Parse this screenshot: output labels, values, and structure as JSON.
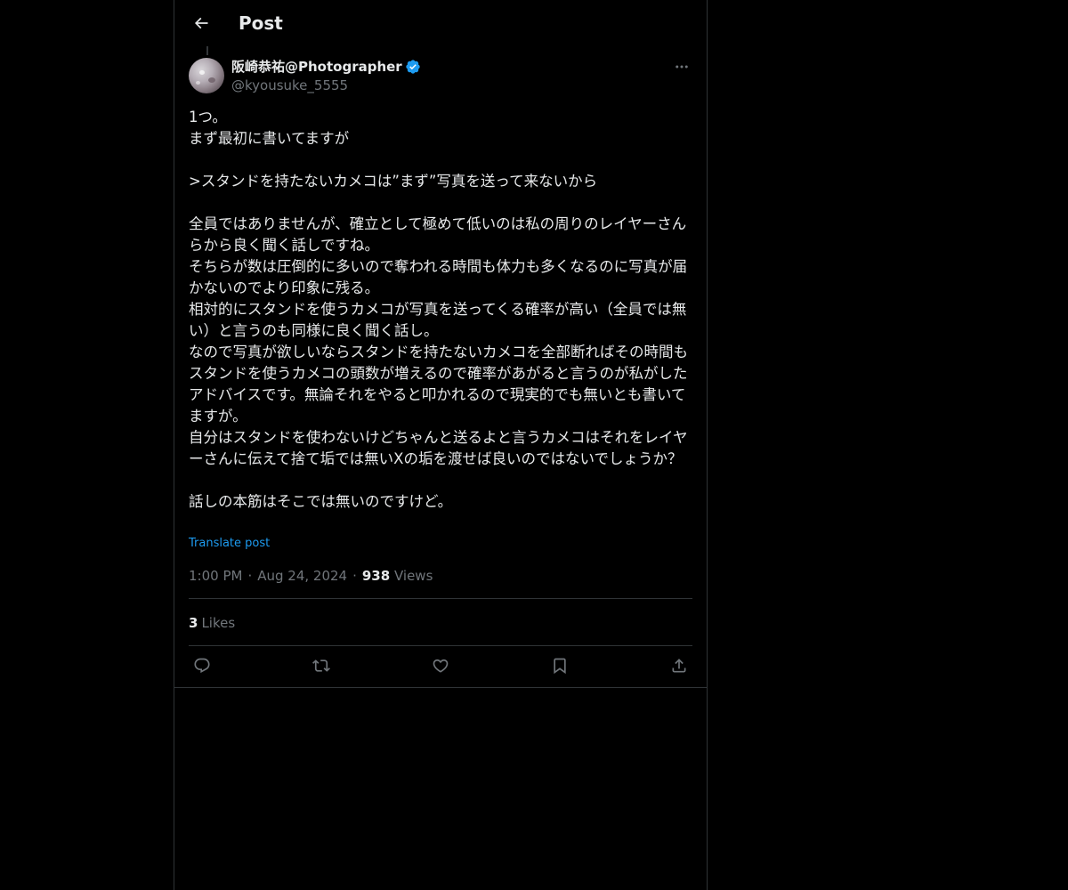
{
  "header": {
    "title": "Post",
    "back_icon": "arrow-left-icon"
  },
  "author": {
    "display_name": "阪崎恭祐@Photographer",
    "handle": "@kyousuke_5555",
    "verified": true,
    "verified_color": "#1d9bf0"
  },
  "post": {
    "text": "1つ。\nまず最初に書いてますが\n\n>スタンドを持たないカメコは”まず”写真を送って来ないから\n\n全員ではありませんが、確立として極めて低いのは私の周りのレイヤーさんらから良く聞く話しですね。\nそちらが数は圧倒的に多いので奪われる時間も体力も多くなるのに写真が届かないのでより印象に残る。\n相対的にスタンドを使うカメコが写真を送ってくる確率が高い（全員では無い）と言うのも同様に良く聞く話し。\nなので写真が欲しいならスタンドを持たないカメコを全部断ればその時間もスタンドを使うカメコの頭数が増えるので確率があがると言うのが私がしたアドバイスです。無論それをやると叩かれるので現実的でも無いとも書いてますが。\n自分はスタンドを使わないけどちゃんと送るよと言うカメコはそれをレイヤーさんに伝えて捨て垢では無いXの垢を渡せば良いのではないでしょうか？\n\n話しの本筋はそこでは無いのですけど。",
    "translate_label": "Translate post",
    "time": "1:00 PM",
    "separator": "·",
    "date": "Aug 24, 2024",
    "views_count": "938",
    "views_label": "Views"
  },
  "stats": {
    "likes_count": "3",
    "likes_label": "Likes"
  },
  "actions": [
    {
      "name": "reply-button",
      "icon": "reply-icon"
    },
    {
      "name": "repost-button",
      "icon": "repost-icon"
    },
    {
      "name": "like-button",
      "icon": "heart-icon"
    },
    {
      "name": "bookmark-button",
      "icon": "bookmark-icon"
    },
    {
      "name": "share-button",
      "icon": "share-icon"
    }
  ],
  "colors": {
    "background": "#000000",
    "text": "#e7e9ea",
    "secondary_text": "#71767b",
    "link": "#1d9bf0",
    "border": "#2f3336"
  }
}
